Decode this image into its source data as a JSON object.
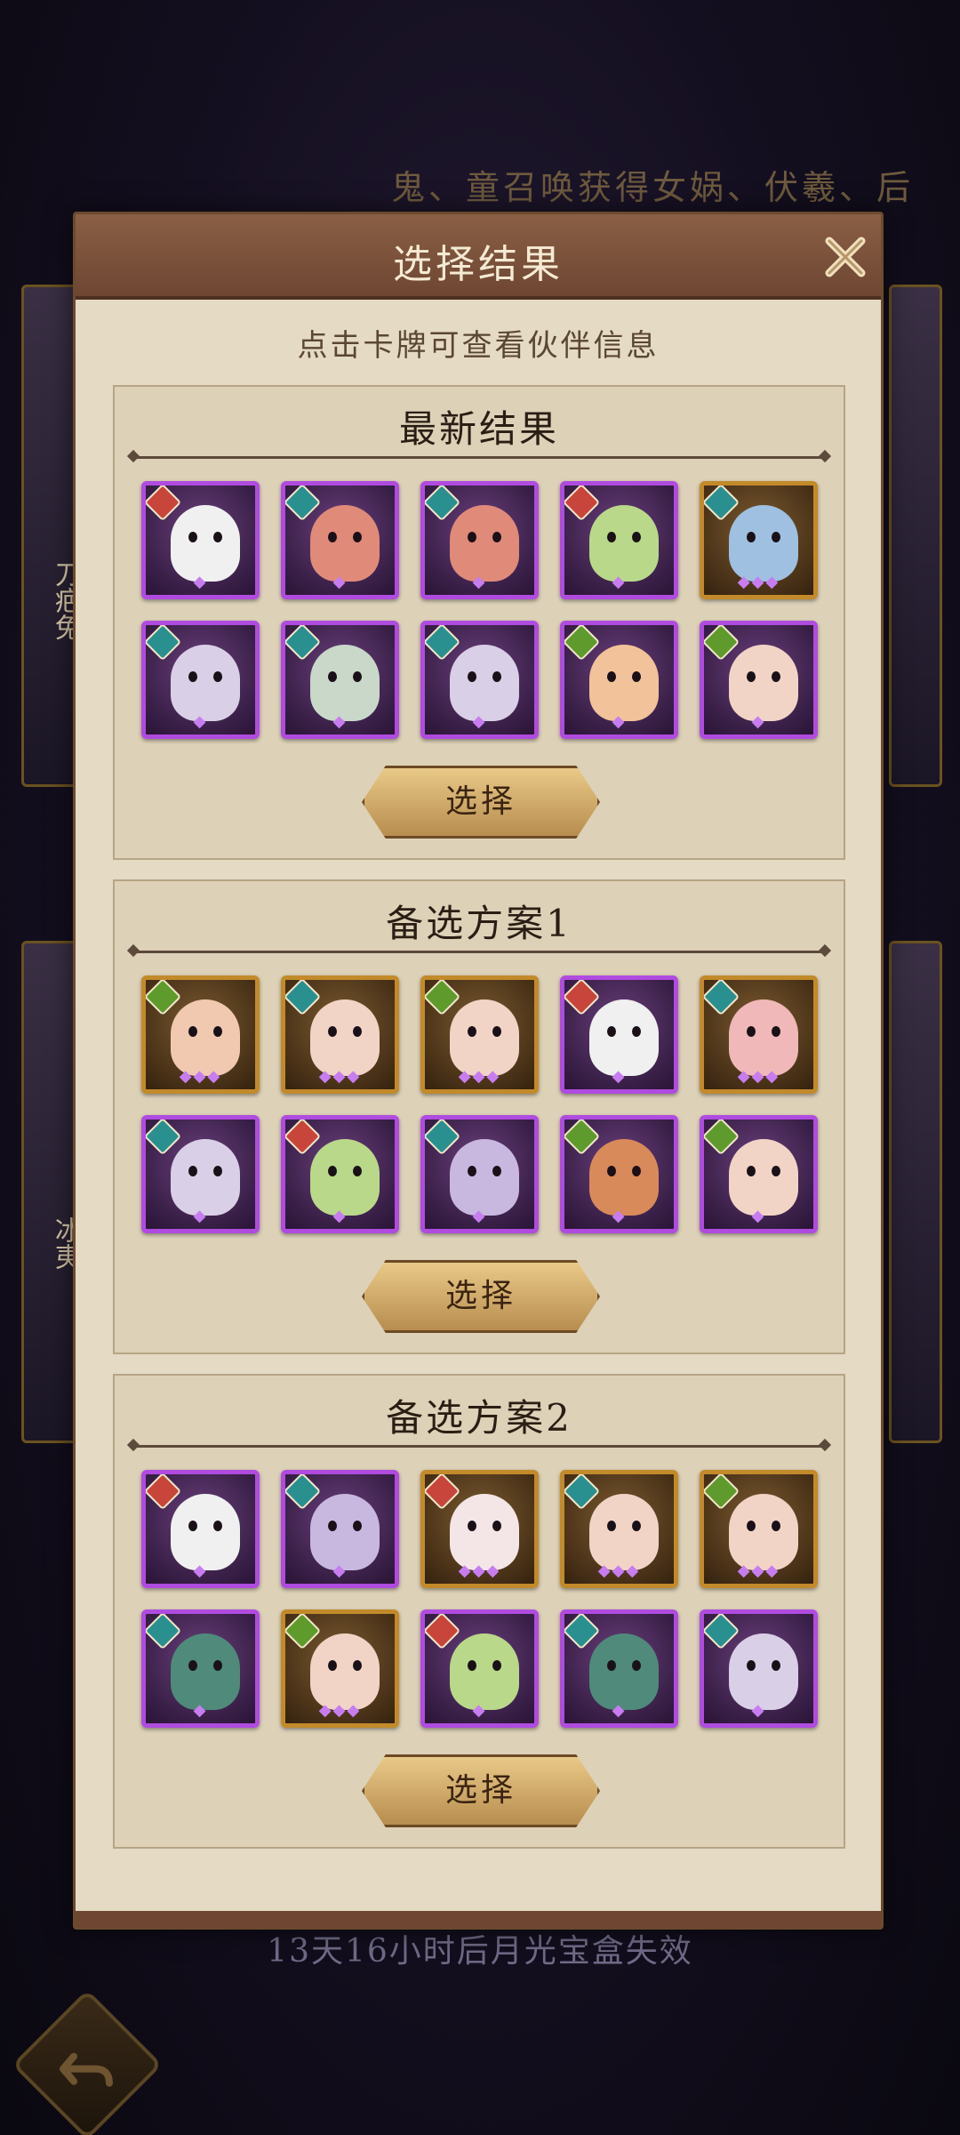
{
  "background": {
    "banner_text": "鬼、童召唤获得女娲、伏羲、后",
    "left_cards": [
      "刀疤兔",
      "冰夷"
    ],
    "footer_text": "13天16小时后月光宝盒失效"
  },
  "modal": {
    "title": "选择结果",
    "hint": "点击卡牌可查看伙伴信息",
    "sections": [
      {
        "title": "最新结果",
        "button": "选择",
        "cards": [
          {
            "element": "fire",
            "rarity": "purple",
            "drops": "💧",
            "face": "#f0f0f0"
          },
          {
            "element": "water",
            "rarity": "purple",
            "drops": "💧",
            "face": "#e08a7a"
          },
          {
            "element": "water",
            "rarity": "purple",
            "drops": "💧",
            "face": "#e08a7a"
          },
          {
            "element": "fire",
            "rarity": "purple",
            "drops": "💧",
            "face": "#b9d88a"
          },
          {
            "element": "water",
            "rarity": "gold",
            "drops": "💧💧💧",
            "face": "#9fc0e0"
          },
          {
            "element": "water",
            "rarity": "purple",
            "drops": "💧",
            "face": "#d9cfe6"
          },
          {
            "element": "water",
            "rarity": "purple",
            "drops": "💧",
            "face": "#c9d8c9"
          },
          {
            "element": "water",
            "rarity": "purple",
            "drops": "💧",
            "face": "#d9cfe6"
          },
          {
            "element": "wind",
            "rarity": "purple",
            "drops": "💧",
            "face": "#f2c39a"
          },
          {
            "element": "wind",
            "rarity": "purple",
            "drops": "💧",
            "face": "#f2d4c6"
          }
        ]
      },
      {
        "title": "备选方案1",
        "button": "选择",
        "cards": [
          {
            "element": "wind",
            "rarity": "gold",
            "drops": "💧💧💧",
            "face": "#f0c9b0"
          },
          {
            "element": "water",
            "rarity": "gold",
            "drops": "💧💧💧",
            "face": "#f2d4c6"
          },
          {
            "element": "wind",
            "rarity": "gold",
            "drops": "💧💧💧",
            "face": "#f2d4c6"
          },
          {
            "element": "fire",
            "rarity": "purple",
            "drops": "💧",
            "face": "#f0f0f0"
          },
          {
            "element": "water",
            "rarity": "gold",
            "drops": "💧💧💧",
            "face": "#f0b8b8"
          },
          {
            "element": "water",
            "rarity": "purple",
            "drops": "💧",
            "face": "#d9cfe6"
          },
          {
            "element": "fire",
            "rarity": "purple",
            "drops": "💧",
            "face": "#b9d88a"
          },
          {
            "element": "water",
            "rarity": "purple",
            "drops": "💧",
            "face": "#c8b8e0"
          },
          {
            "element": "wind",
            "rarity": "purple",
            "drops": "💧",
            "face": "#d98a5a"
          },
          {
            "element": "wind",
            "rarity": "purple",
            "drops": "💧",
            "face": "#f2d4c6"
          }
        ]
      },
      {
        "title": "备选方案2",
        "button": "选择",
        "cards": [
          {
            "element": "fire",
            "rarity": "purple",
            "drops": "💧",
            "face": "#f0f0f0"
          },
          {
            "element": "water",
            "rarity": "purple",
            "drops": "💧",
            "face": "#c8b8e0"
          },
          {
            "element": "fire",
            "rarity": "gold",
            "drops": "💧💧💧",
            "face": "#f4e6e6"
          },
          {
            "element": "water",
            "rarity": "gold",
            "drops": "💧💧💧",
            "face": "#f2d4c6"
          },
          {
            "element": "wind",
            "rarity": "gold",
            "drops": "💧💧💧",
            "face": "#f2d4c6"
          },
          {
            "element": "water",
            "rarity": "purple",
            "drops": "💧",
            "face": "#4f8a7a"
          },
          {
            "element": "wind",
            "rarity": "gold",
            "drops": "💧💧💧",
            "face": "#f2d4c6"
          },
          {
            "element": "fire",
            "rarity": "purple",
            "drops": "💧",
            "face": "#b9d88a"
          },
          {
            "element": "water",
            "rarity": "purple",
            "drops": "💧",
            "face": "#4f8a7a"
          },
          {
            "element": "water",
            "rarity": "purple",
            "drops": "💧",
            "face": "#d9cfe6"
          }
        ]
      }
    ]
  },
  "colors": {
    "purple_border": "#b04be0",
    "gold_border": "#c28a2a",
    "element_fire": "#c8453b",
    "element_water": "#2a8f8f",
    "element_wind": "#5e9a2c"
  }
}
